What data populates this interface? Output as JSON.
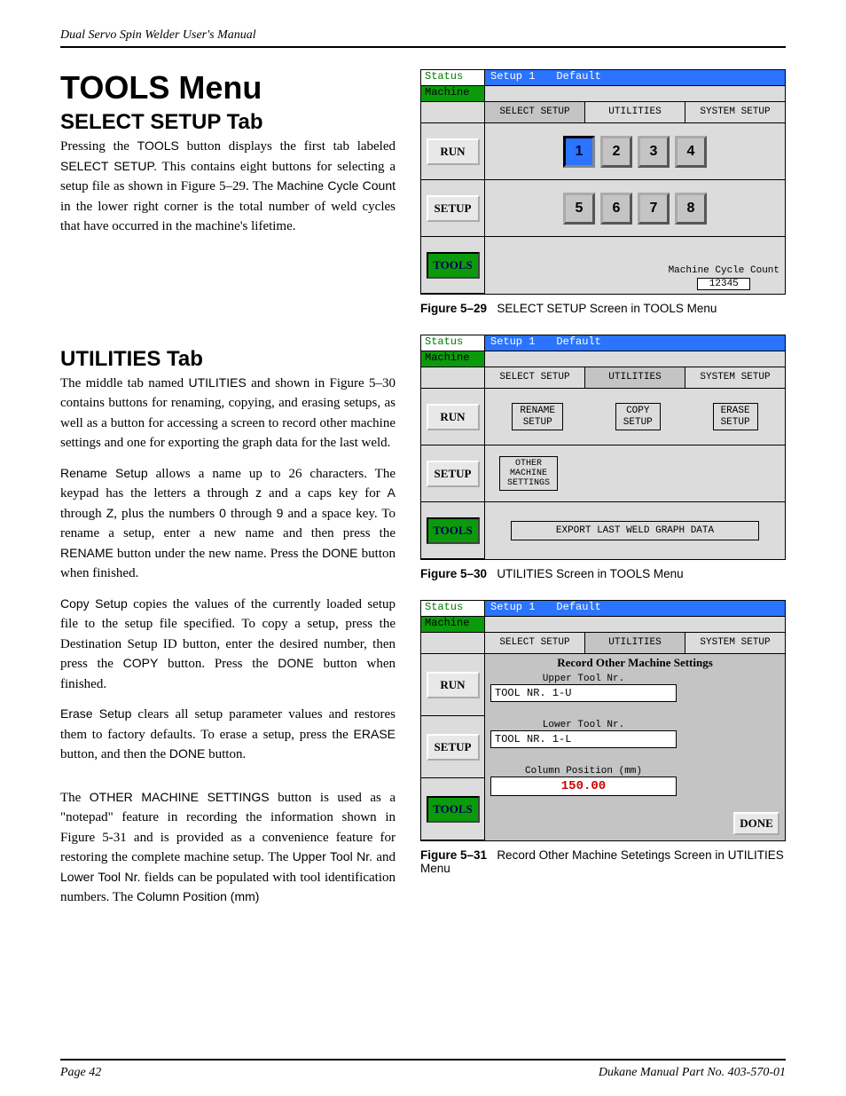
{
  "header": "Dual Servo Spin Welder User's Manual",
  "h1": "TOOLS Menu",
  "h2a": "SELECT SETUP Tab",
  "para1_parts": [
    {
      "t": "Pressing the "
    },
    {
      "t": "TOOLS",
      "sans": true
    },
    {
      "t": " button displays the first tab labeled "
    },
    {
      "t": "SELECT SETUP.",
      "sans": true
    },
    {
      "t": " This contains eight buttons for selecting a setup file as shown in Figure 5–29. The "
    },
    {
      "t": "Machine Cycle Count",
      "sans": true
    },
    {
      "t": " in the lower right corner is the total number of weld cycles that have occurred in the machine's lifetime."
    }
  ],
  "h2b": "UTILITIES Tab",
  "para2_parts": [
    {
      "t": "The middle tab named "
    },
    {
      "t": "UTILITIES",
      "sans": true
    },
    {
      "t": " and shown in Figure 5–30 contains buttons for renaming, copying, and erasing setups, as well as a button for accessing a screen to record other machine settings and one for exporting the graph data for the last weld."
    }
  ],
  "para3_parts": [
    {
      "t": "Rename Setup",
      "sans": true
    },
    {
      "t": " allows a name up to 26 characters. The keypad has the letters "
    },
    {
      "t": "a",
      "sans": true
    },
    {
      "t": " through "
    },
    {
      "t": "z",
      "sans": true
    },
    {
      "t": " and a caps key for "
    },
    {
      "t": "A",
      "sans": true
    },
    {
      "t": " through "
    },
    {
      "t": "Z",
      "sans": true
    },
    {
      "t": ", plus the numbers "
    },
    {
      "t": "0",
      "sans": true
    },
    {
      "t": " through "
    },
    {
      "t": "9",
      "sans": true
    },
    {
      "t": " and a space key. To rename a setup, enter a new name and then press the "
    },
    {
      "t": "RENAME",
      "sans": true
    },
    {
      "t": " button under the new name. Press the "
    },
    {
      "t": "DONE",
      "sans": true
    },
    {
      "t": " button when finished."
    }
  ],
  "para4_parts": [
    {
      "t": "Copy Setup",
      "sans": true
    },
    {
      "t": " copies the values of the currently loaded setup file to the setup file specified. To copy a setup, press the Destination Setup ID button, enter the desired number, then press the "
    },
    {
      "t": "COPY",
      "sans": true
    },
    {
      "t": " button. Press the "
    },
    {
      "t": "DONE",
      "sans": true
    },
    {
      "t": " button when finished."
    }
  ],
  "para5_parts": [
    {
      "t": "Erase Setup",
      "sans": true
    },
    {
      "t": " clears all setup parameter values and restores them to factory defaults. To erase a setup, press the "
    },
    {
      "t": "ERASE",
      "sans": true
    },
    {
      "t": " button, and then the "
    },
    {
      "t": "DONE",
      "sans": true
    },
    {
      "t": " button."
    }
  ],
  "para6_parts": [
    {
      "t": "The "
    },
    {
      "t": "OTHER MACHINE SETTINGS",
      "sans": true
    },
    {
      "t": " button is used as a \"notepad\" feature in recording the information shown in Figure 5-31 and is provided as a convenience feature for restoring the complete machine setup. The "
    },
    {
      "t": "Upper Tool Nr.",
      "sans": true
    },
    {
      "t": " and "
    },
    {
      "t": "Lower Tool Nr.",
      "sans": true
    },
    {
      "t": " fields can be populated with tool identification numbers. The "
    },
    {
      "t": "Column Position (mm)",
      "sans": true
    }
  ],
  "fig29_caption_bold": "Figure 5–29",
  "fig29_caption": "SELECT SETUP Screen in TOOLS Menu",
  "fig30_caption_bold": "Figure 5–30",
  "fig30_caption": "UTILITIES Screen in TOOLS Menu",
  "fig31_caption_bold": "Figure 5–31",
  "fig31_caption": "Record Other Machine Setetings Screen in UTILITIES Menu",
  "panel": {
    "status": "Status",
    "machine": "Machine",
    "setup_name": "Setup 1",
    "default": "Default",
    "tabs": [
      "SELECT SETUP",
      "UTILITIES",
      "SYSTEM SETUP"
    ],
    "side": [
      "RUN",
      "SETUP",
      "TOOLS"
    ],
    "nums1": [
      "1",
      "2",
      "3",
      "4"
    ],
    "nums2": [
      "5",
      "6",
      "7",
      "8"
    ],
    "mcc_label": "Machine Cycle Count",
    "mcc_value": "12345",
    "util_btns": [
      "RENAME\nSETUP",
      "COPY\nSETUP",
      "ERASE\nSETUP"
    ],
    "other_btn": "OTHER\nMACHINE\nSETTINGS",
    "export_btn": "EXPORT LAST WELD GRAPH DATA",
    "roms_title": "Record Other Machine Settings",
    "upper_label": "Upper Tool Nr.",
    "upper_val": "TOOL NR. 1-U",
    "lower_label": "Lower Tool Nr.",
    "lower_val": "TOOL NR. 1-L",
    "colpos_label": "Column Position (mm)",
    "colpos_val": "150.00",
    "done": "DONE"
  },
  "footer_left": "Page   42",
  "footer_right": "Dukane Manual Part No. 403-570-01"
}
